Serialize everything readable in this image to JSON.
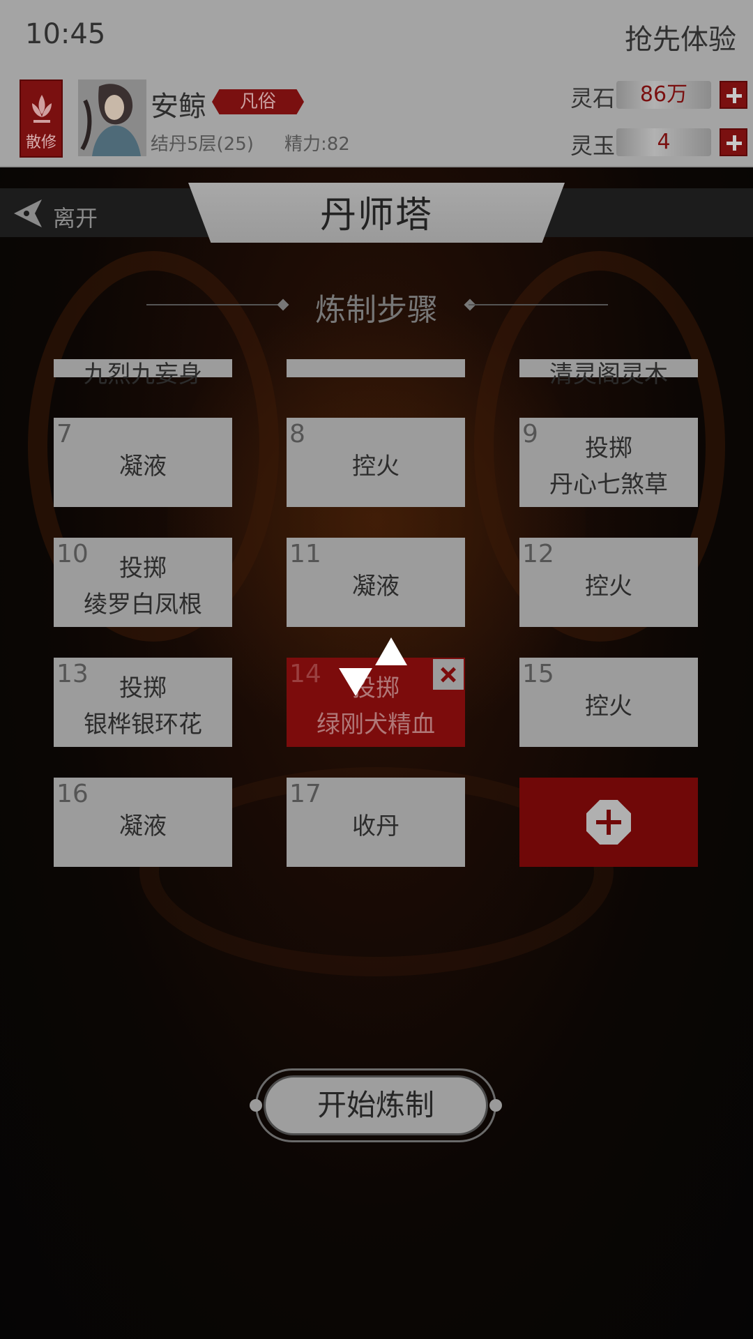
{
  "status_bar": {
    "time": "10:45",
    "early_access": "抢先体验"
  },
  "player": {
    "sect": "散修",
    "name": "安鲸",
    "rank": "凡俗",
    "realm": "结丹5层(25)",
    "energy": "精力:82"
  },
  "resources": {
    "spirit_stone": {
      "label": "灵石",
      "value": "86万"
    },
    "spirit_jade": {
      "label": "灵玉",
      "value": "4"
    }
  },
  "nav": {
    "leave_label": "离开",
    "title": "丹师塔"
  },
  "section": {
    "title": "炼制步骤"
  },
  "steps_partial": [
    {
      "text": "九烈九妄身"
    },
    {
      "text": ""
    },
    {
      "text": "清灵阁灵木"
    }
  ],
  "steps": [
    {
      "num": "7",
      "action": "凝液",
      "material": ""
    },
    {
      "num": "8",
      "action": "控火",
      "material": ""
    },
    {
      "num": "9",
      "action": "投掷",
      "material": "丹心七煞草"
    },
    {
      "num": "10",
      "action": "投掷",
      "material": "绫罗白凤根"
    },
    {
      "num": "11",
      "action": "凝液",
      "material": ""
    },
    {
      "num": "12",
      "action": "控火",
      "material": ""
    },
    {
      "num": "13",
      "action": "投掷",
      "material": "银桦银环花"
    },
    {
      "num": "14",
      "action": "投掷",
      "material": "绿刚犬精血",
      "selected": true
    },
    {
      "num": "15",
      "action": "控火",
      "material": ""
    },
    {
      "num": "16",
      "action": "凝液",
      "material": ""
    },
    {
      "num": "17",
      "action": "收丹",
      "material": ""
    }
  ],
  "actions": {
    "start_label": "开始炼制"
  },
  "colors": {
    "accent": "#7c0c0c",
    "panel": "#9c9c9c",
    "header": "#a4a4a4"
  }
}
